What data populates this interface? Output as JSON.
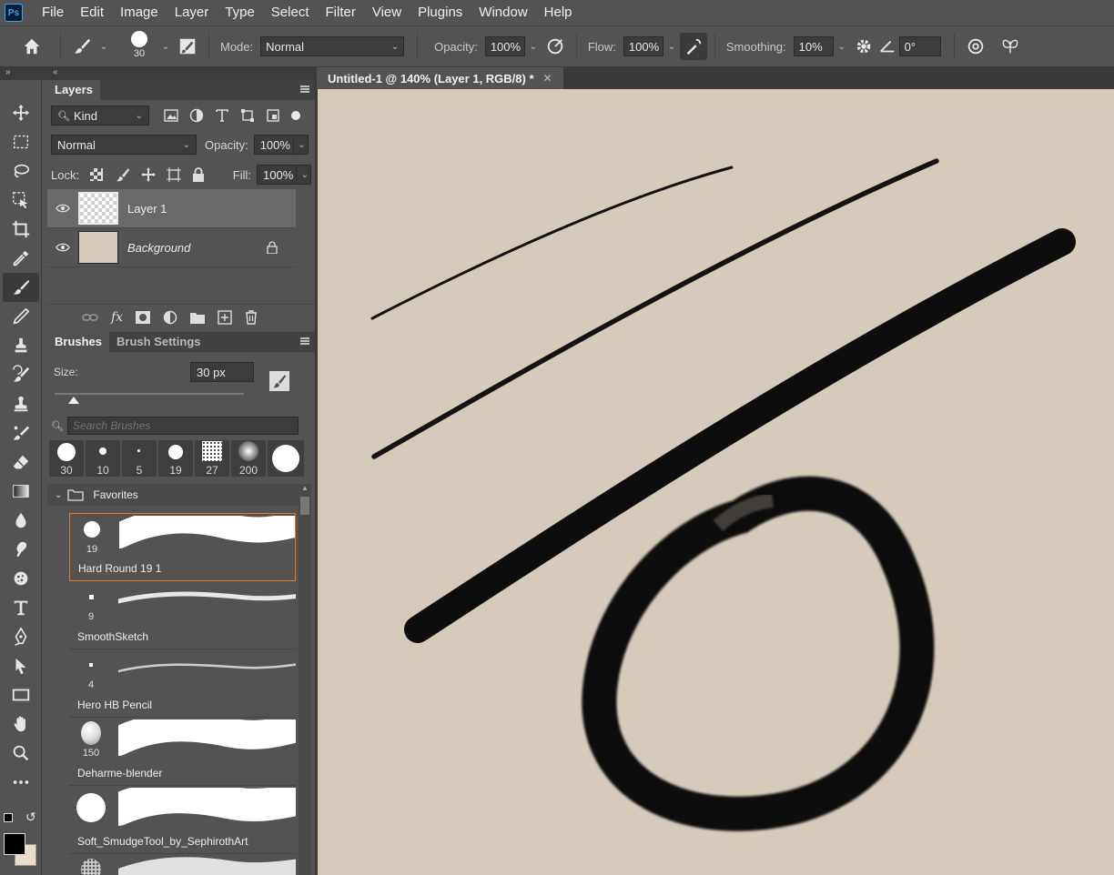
{
  "app": {
    "logo": "Ps"
  },
  "menu": [
    "File",
    "Edit",
    "Image",
    "Layer",
    "Type",
    "Select",
    "Filter",
    "View",
    "Plugins",
    "Window",
    "Help"
  ],
  "options": {
    "brush_size": "30",
    "mode_label": "Mode:",
    "mode_value": "Normal",
    "opacity_label": "Opacity:",
    "opacity_value": "100%",
    "flow_label": "Flow:",
    "flow_value": "100%",
    "smoothing_label": "Smoothing:",
    "smoothing_value": "10%",
    "angle_value": "0°"
  },
  "layers_panel": {
    "tab": "Layers",
    "filter_value": "Kind",
    "blend_value": "Normal",
    "opacity_label": "Opacity:",
    "opacity_value": "100%",
    "lock_label": "Lock:",
    "fill_label": "Fill:",
    "fill_value": "100%",
    "layers": [
      {
        "name": "Layer 1"
      },
      {
        "name": "Background"
      }
    ]
  },
  "brushes_panel": {
    "tab_brushes": "Brushes",
    "tab_settings": "Brush Settings",
    "size_label": "Size:",
    "size_value": "30 px",
    "size_slider_fraction": 0.1,
    "search_placeholder": "Search Brushes",
    "presets": [
      "30",
      "10",
      "5",
      "19",
      "27",
      "200"
    ],
    "group_name": "Favorites",
    "items": [
      {
        "size": "19",
        "name": "Hard Round 19 1"
      },
      {
        "size": "9",
        "name": "SmoothSketch"
      },
      {
        "size": "4",
        "name": "Hero HB Pencil"
      },
      {
        "size": "150",
        "name": "Deharme-blender"
      },
      {
        "size": "",
        "name": "Soft_SmudgeTool_by_SephirothArt"
      }
    ]
  },
  "document": {
    "tab_title": "Untitled-1 @ 140% (Layer 1, RGB/8) *",
    "canvas_color": "#d6cabb"
  },
  "colors": {
    "foreground": "#000000",
    "background": "#e9dccd",
    "accent": "#e87b2a"
  }
}
